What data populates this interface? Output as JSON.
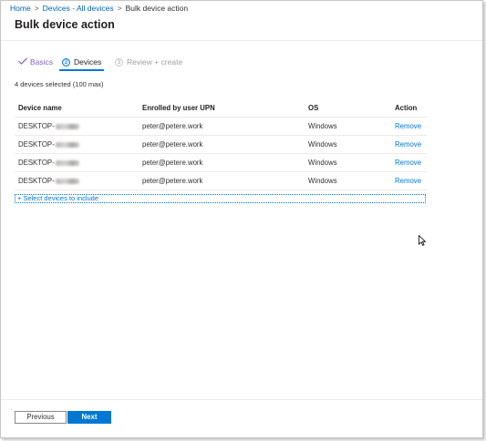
{
  "breadcrumb": {
    "items": [
      "Home",
      "Devices - All devices",
      "Bulk device action"
    ]
  },
  "page": {
    "title": "Bulk device action"
  },
  "tabs": [
    {
      "label": "Basics",
      "state": "completed",
      "icon": "check-icon"
    },
    {
      "label": "Devices",
      "step": "2",
      "state": "active"
    },
    {
      "label": "Review + create",
      "step": "3",
      "state": "disabled"
    }
  ],
  "selection": {
    "summary": "4 devices selected (100 max)"
  },
  "table": {
    "headers": [
      "Device name",
      "Enrolled by user UPN",
      "OS",
      "Action"
    ],
    "rows": [
      {
        "device": "DESKTOP-",
        "upn": "peter@petere.work",
        "os": "Windows",
        "action": "Remove"
      },
      {
        "device": "DESKTOP-",
        "upn": "peter@petere.work",
        "os": "Windows",
        "action": "Remove"
      },
      {
        "device": "DESKTOP-",
        "upn": "peter@petere.work",
        "os": "Windows",
        "action": "Remove"
      },
      {
        "device": "DESKTOP-",
        "upn": "peter@petere.work",
        "os": "Windows",
        "action": "Remove"
      }
    ]
  },
  "select_devices": {
    "label": "+ Select devices to include"
  },
  "footer": {
    "previous_label": "Previous",
    "next_label": "Next"
  },
  "colors": {
    "accent": "#0078d4",
    "completed_tab": "#8764b8",
    "link": "#0063b1"
  }
}
